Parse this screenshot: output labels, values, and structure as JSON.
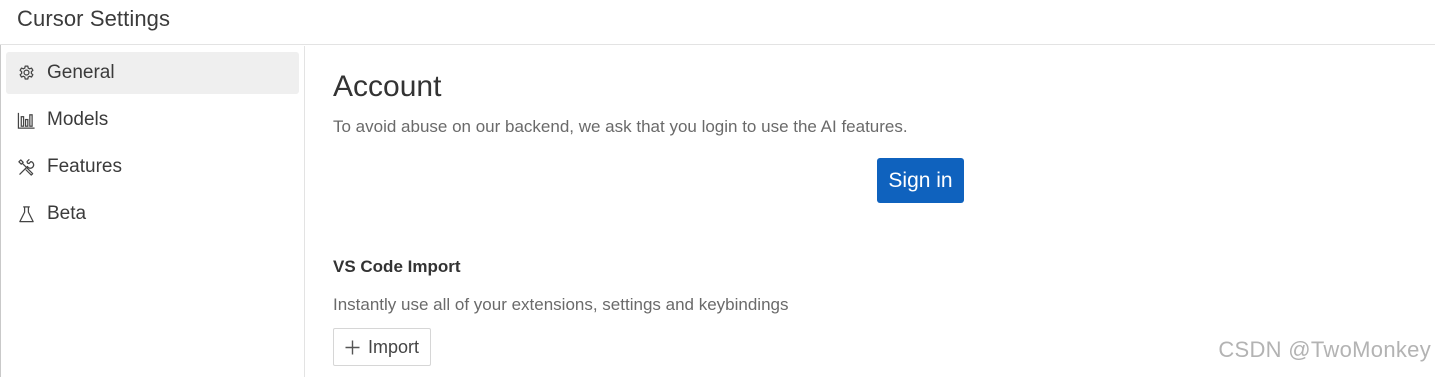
{
  "window": {
    "title": "Cursor Settings"
  },
  "sidebar": {
    "items": [
      {
        "label": "General",
        "icon": "gear-icon",
        "active": true
      },
      {
        "label": "Models",
        "icon": "bar-chart-icon",
        "active": false
      },
      {
        "label": "Features",
        "icon": "tools-icon",
        "active": false
      },
      {
        "label": "Beta",
        "icon": "flask-icon",
        "active": false
      }
    ]
  },
  "account": {
    "heading": "Account",
    "description": "To avoid abuse on our backend, we ask that you login to use the AI features.",
    "sign_in_label": "Sign in"
  },
  "vscode_import": {
    "heading": "VS Code Import",
    "description": "Instantly use all of your extensions, settings and keybindings",
    "import_label": "Import",
    "import_icon": "plus-icon"
  },
  "watermark": "CSDN @TwoMonkey",
  "colors": {
    "primary_button": "#0f62be",
    "active_nav_bg": "#efefef",
    "muted_text": "#6a6a6a"
  }
}
